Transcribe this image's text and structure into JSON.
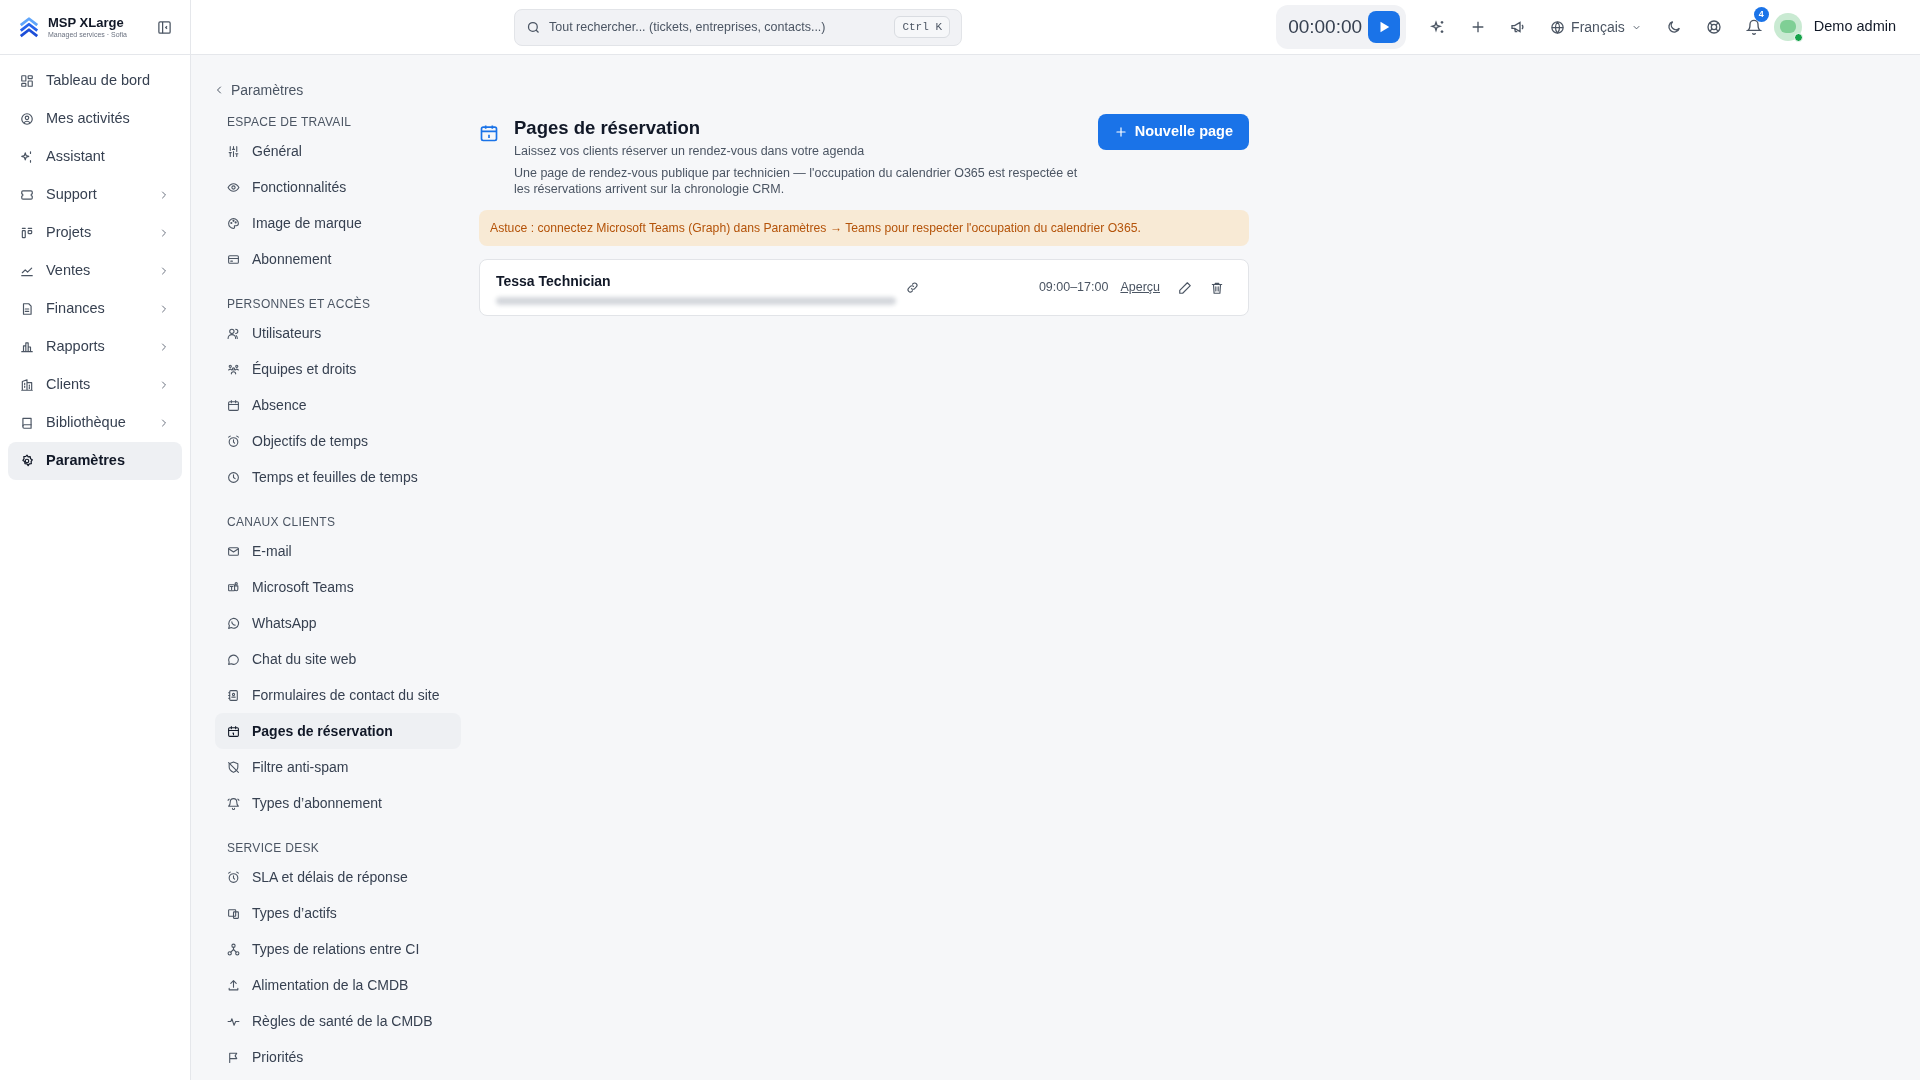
{
  "brand": {
    "name": "MSP XLarge",
    "tagline": "Managed services · Sofia"
  },
  "sidebar": {
    "items": [
      {
        "label": "Tableau de bord",
        "kind": "link",
        "selected": false
      },
      {
        "label": "Mes activités",
        "kind": "link",
        "selected": false
      },
      {
        "label": "Assistant",
        "kind": "link",
        "selected": false
      },
      {
        "label": "Support",
        "kind": "group",
        "selected": false
      },
      {
        "label": "Projets",
        "kind": "group",
        "selected": false
      },
      {
        "label": "Ventes",
        "kind": "group",
        "selected": false
      },
      {
        "label": "Finances",
        "kind": "group",
        "selected": false
      },
      {
        "label": "Rapports",
        "kind": "group",
        "selected": false
      },
      {
        "label": "Clients",
        "kind": "group",
        "selected": false
      },
      {
        "label": "Bibliothèque",
        "kind": "group",
        "selected": false
      },
      {
        "label": "Paramètres",
        "kind": "link",
        "selected": true
      }
    ]
  },
  "topbar": {
    "search": {
      "placeholder": "Tout rechercher... (tickets, entreprises, contacts...)",
      "shortcut": "Ctrl K"
    },
    "timer": "00:00:00",
    "language": "Français",
    "notifications": "4",
    "user": "Demo admin"
  },
  "settings_nav": {
    "back": "Paramètres",
    "sections": [
      {
        "title": "ESPACE DE TRAVAIL",
        "items": [
          {
            "label": "Général",
            "selected": false
          },
          {
            "label": "Fonctionnalités",
            "selected": false
          },
          {
            "label": "Image de marque",
            "selected": false
          },
          {
            "label": "Abonnement",
            "selected": false
          }
        ]
      },
      {
        "title": "PERSONNES ET ACCÈS",
        "items": [
          {
            "label": "Utilisateurs",
            "selected": false
          },
          {
            "label": "Équipes et droits",
            "selected": false
          },
          {
            "label": "Absence",
            "selected": false
          },
          {
            "label": "Objectifs de temps",
            "selected": false
          },
          {
            "label": "Temps et feuilles de temps",
            "selected": false
          }
        ]
      },
      {
        "title": "CANAUX CLIENTS",
        "items": [
          {
            "label": "E-mail",
            "selected": false
          },
          {
            "label": "Microsoft Teams",
            "selected": false
          },
          {
            "label": "WhatsApp",
            "selected": false
          },
          {
            "label": "Chat du site web",
            "selected": false
          },
          {
            "label": "Formulaires de contact du site",
            "selected": false
          },
          {
            "label": "Pages de réservation",
            "selected": true
          },
          {
            "label": "Filtre anti-spam",
            "selected": false
          },
          {
            "label": "Types d’abonnement",
            "selected": false
          }
        ]
      },
      {
        "title": "SERVICE DESK",
        "items": [
          {
            "label": "SLA et délais de réponse",
            "selected": false
          },
          {
            "label": "Types d’actifs",
            "selected": false
          },
          {
            "label": "Types de relations entre CI",
            "selected": false
          },
          {
            "label": "Alimentation de la CMDB",
            "selected": false
          },
          {
            "label": "Règles de santé de la CMDB",
            "selected": false
          },
          {
            "label": "Priorités",
            "selected": false
          }
        ]
      }
    ]
  },
  "page": {
    "title": "Pages de réservation",
    "subtitle": "Laissez vos clients réserver un rendez-vous dans votre agenda",
    "description": "Une page de rendez-vous publique par technicien — l'occupation du calendrier O365 est respectée et les réservations arrivent sur la chronologie CRM.",
    "new_button": "Nouvelle page",
    "tip": "Astuce : connectez Microsoft Teams (Graph) dans Paramètres → Teams pour respecter l'occupation du calendrier O365.",
    "booking_pages": [
      {
        "name": "Tessa Technician",
        "hours": "09:00–17:00",
        "preview": "Aperçu"
      }
    ]
  }
}
